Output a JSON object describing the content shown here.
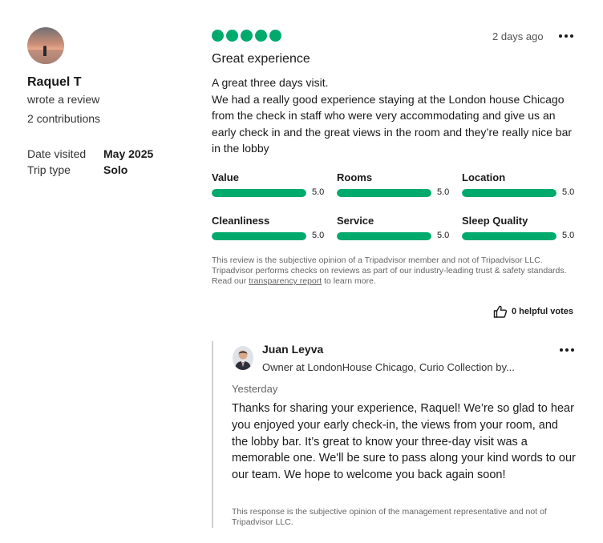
{
  "reviewer": {
    "name": "Raquel T",
    "action": "wrote a review",
    "contributions": "2 contributions",
    "date_visited_label": "Date visited",
    "date_visited_value": "May 2025",
    "trip_type_label": "Trip type",
    "trip_type_value": "Solo"
  },
  "review": {
    "rating": 5,
    "date": "2 days ago",
    "title": "Great experience",
    "body_line1": "A great three days visit.",
    "body_line2": "We had a really good experience staying at the London house Chicago from the check in staff who were very accommodating and give us an early check in and the great views in the room and they’re really nice bar in the lobby",
    "accent_color": "#00aa6c"
  },
  "subratings": [
    {
      "label": "Value",
      "value": "5.0",
      "fraction": 1.0
    },
    {
      "label": "Rooms",
      "value": "5.0",
      "fraction": 1.0
    },
    {
      "label": "Location",
      "value": "5.0",
      "fraction": 1.0
    },
    {
      "label": "Cleanliness",
      "value": "5.0",
      "fraction": 1.0
    },
    {
      "label": "Service",
      "value": "5.0",
      "fraction": 1.0
    },
    {
      "label": "Sleep Quality",
      "value": "5.0",
      "fraction": 1.0
    }
  ],
  "disclaimer": {
    "text_before": "This review is the subjective opinion of a Tripadvisor member and not of Tripadvisor LLC. Tripadvisor performs checks on reviews as part of our industry-leading trust & safety standards. Read our ",
    "link": "transparency report",
    "text_after": " to learn more."
  },
  "helpful": {
    "label": "0 helpful votes",
    "icon": "thumbs-up-icon"
  },
  "response": {
    "name": "Juan Leyva",
    "role": "Owner at LondonHouse Chicago, Curio Collection by...",
    "date": "Yesterday",
    "body": "Thanks for sharing your experience, Raquel! We’re so glad to hear you enjoyed your early check-in, the views from your room, and the lobby bar. It’s great to know your three-day visit was a memorable one. We'll be sure to pass along your kind words to our our team. We hope to welcome you back again soon!",
    "disclaimer": "This response is the subjective opinion of the management representative and not of Tripadvisor LLC."
  }
}
